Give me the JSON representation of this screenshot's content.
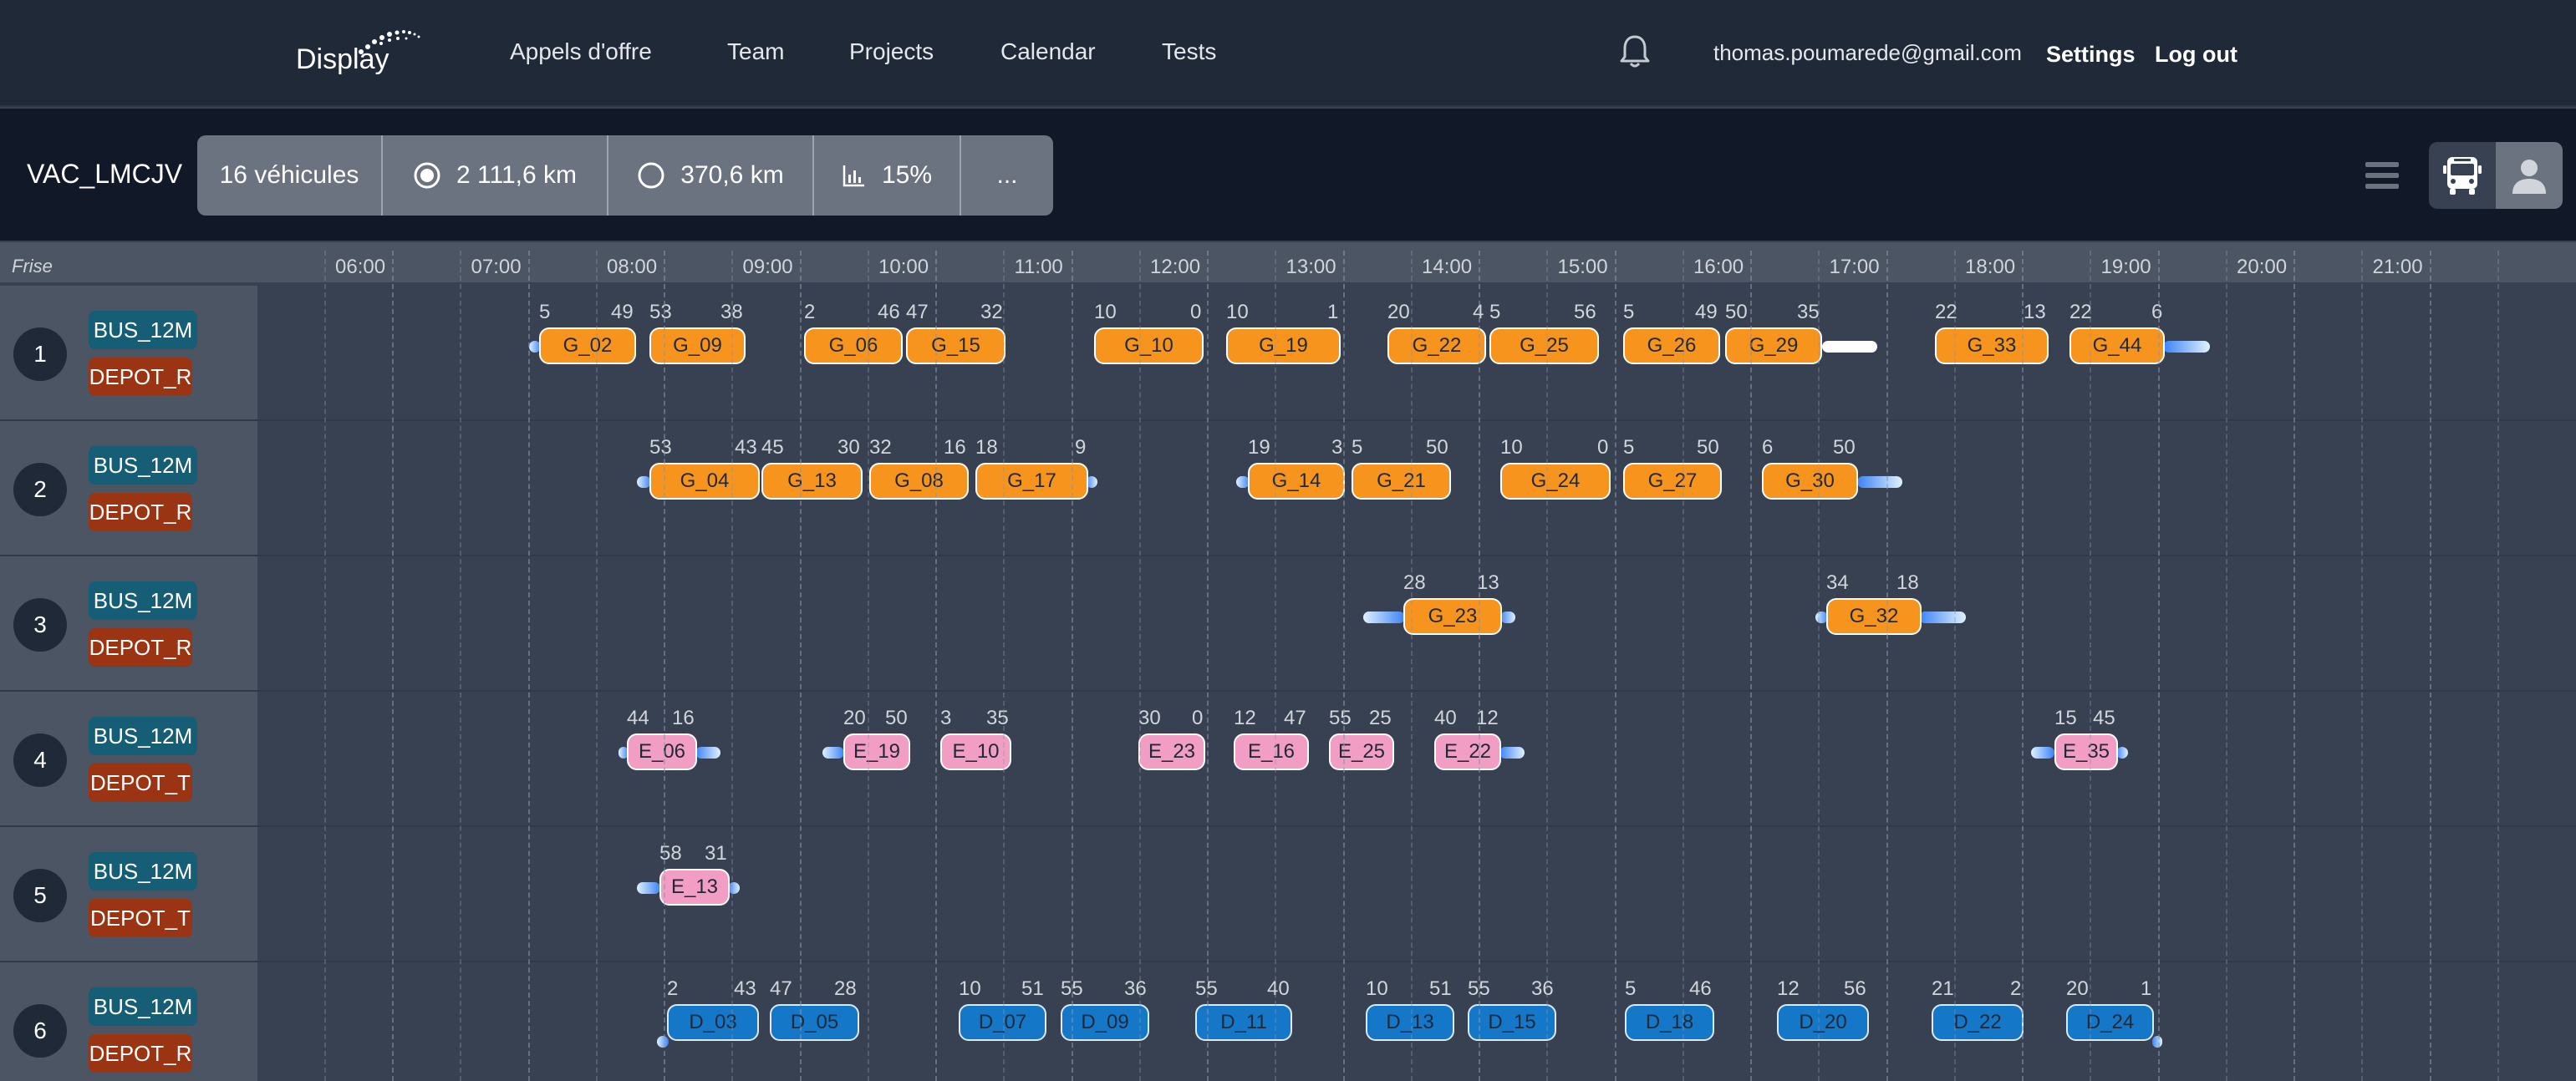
{
  "nav": {
    "logo_text": "Display",
    "links": [
      "Appels d'offre",
      "Team",
      "Projects",
      "Calendar",
      "Tests"
    ],
    "user_email": "thomas.poumarede@gmail.com",
    "settings": "Settings",
    "logout": "Log out"
  },
  "toolbar": {
    "scenario": "VAC_LMCJV",
    "stats": {
      "vehicles": "16 véhicules",
      "commercial_km": "2 111,6 km",
      "deadhead_km": "370,6 km",
      "ratio": "15%",
      "more": "..."
    }
  },
  "timeline": {
    "frise_label": "Frise",
    "hours": [
      "06:00",
      "07:00",
      "08:00",
      "09:00",
      "10:00",
      "11:00",
      "12:00",
      "13:00",
      "14:00",
      "15:00",
      "16:00",
      "17:00",
      "18:00",
      "19:00",
      "20:00",
      "21:00"
    ]
  },
  "rows": [
    {
      "num": "1",
      "bus": "BUS_12M",
      "depot": "DEPOT_R",
      "trips": [
        {
          "label": "G_02",
          "c": "orange",
          "s": "5",
          "e": "49"
        },
        {
          "label": "G_09",
          "c": "orange",
          "s": "53",
          "e": "38"
        },
        {
          "label": "G_06",
          "c": "orange",
          "s": "2",
          "e": "46"
        },
        {
          "label": "G_15",
          "c": "orange",
          "s": "47",
          "e": "32"
        },
        {
          "label": "G_10",
          "c": "orange",
          "s": "10",
          "e": "0"
        },
        {
          "label": "G_19",
          "c": "orange",
          "s": "10",
          "e": "1"
        },
        {
          "label": "G_22",
          "c": "orange",
          "s": "20",
          "e": "4"
        },
        {
          "label": "G_25",
          "c": "orange",
          "s": "5",
          "e": "56"
        },
        {
          "label": "G_26",
          "c": "orange",
          "s": "5",
          "e": "49"
        },
        {
          "label": "G_29",
          "c": "orange",
          "s": "50",
          "e": "35"
        },
        {
          "label": "G_33",
          "c": "orange",
          "s": "22",
          "e": "13"
        },
        {
          "label": "G_44",
          "c": "orange",
          "s": "22",
          "e": "6"
        }
      ]
    },
    {
      "num": "2",
      "bus": "BUS_12M",
      "depot": "DEPOT_R",
      "trips": [
        {
          "label": "G_04",
          "c": "orange",
          "s": "53",
          "e": "43"
        },
        {
          "label": "G_13",
          "c": "orange",
          "s": "45",
          "e": "30"
        },
        {
          "label": "G_08",
          "c": "orange",
          "s": "32",
          "e": "16"
        },
        {
          "label": "G_17",
          "c": "orange",
          "s": "18",
          "e": "9"
        },
        {
          "label": "G_14",
          "c": "orange",
          "s": "19",
          "e": "3"
        },
        {
          "label": "G_21",
          "c": "orange",
          "s": "5",
          "e": "50"
        },
        {
          "label": "G_24",
          "c": "orange",
          "s": "10",
          "e": "0"
        },
        {
          "label": "G_27",
          "c": "orange",
          "s": "5",
          "e": "50"
        },
        {
          "label": "G_30",
          "c": "orange",
          "s": "6",
          "e": "50"
        }
      ]
    },
    {
      "num": "3",
      "bus": "BUS_12M",
      "depot": "DEPOT_R",
      "trips": [
        {
          "label": "G_23",
          "c": "orange",
          "s": "28",
          "e": "13"
        },
        {
          "label": "G_32",
          "c": "orange",
          "s": "34",
          "e": "18"
        }
      ]
    },
    {
      "num": "4",
      "bus": "BUS_12M",
      "depot": "DEPOT_T",
      "trips": [
        {
          "label": "E_06",
          "c": "pink",
          "s": "44",
          "e": "16"
        },
        {
          "label": "E_19",
          "c": "pink",
          "s": "20",
          "e": "50"
        },
        {
          "label": "E_10",
          "c": "pink",
          "s": "3",
          "e": "35"
        },
        {
          "label": "E_23",
          "c": "pink",
          "s": "30",
          "e": "0"
        },
        {
          "label": "E_16",
          "c": "pink",
          "s": "12",
          "e": "47"
        },
        {
          "label": "E_25",
          "c": "pink",
          "s": "55",
          "e": "25"
        },
        {
          "label": "E_22",
          "c": "pink",
          "s": "40",
          "e": "12"
        },
        {
          "label": "E_35",
          "c": "pink",
          "s": "15",
          "e": "45"
        }
      ]
    },
    {
      "num": "5",
      "bus": "BUS_12M",
      "depot": "DEPOT_T",
      "trips": [
        {
          "label": "E_13",
          "c": "pink",
          "s": "58",
          "e": "31"
        }
      ]
    },
    {
      "num": "6",
      "bus": "BUS_12M",
      "depot": "DEPOT_R",
      "trips": [
        {
          "label": "D_03",
          "c": "blue",
          "s": "2",
          "e": "43"
        },
        {
          "label": "D_05",
          "c": "blue",
          "s": "47",
          "e": "28"
        },
        {
          "label": "D_07",
          "c": "blue",
          "s": "10",
          "e": "51"
        },
        {
          "label": "D_09",
          "c": "blue",
          "s": "55",
          "e": "36"
        },
        {
          "label": "D_11",
          "c": "blue",
          "s": "55",
          "e": "40"
        },
        {
          "label": "D_13",
          "c": "blue",
          "s": "10",
          "e": "51"
        },
        {
          "label": "D_15",
          "c": "blue",
          "s": "55",
          "e": "36"
        },
        {
          "label": "D_18",
          "c": "blue",
          "s": "5",
          "e": "46"
        },
        {
          "label": "D_20",
          "c": "blue",
          "s": "12",
          "e": "56"
        },
        {
          "label": "D_22",
          "c": "blue",
          "s": "21",
          "e": "2"
        },
        {
          "label": "D_24",
          "c": "blue",
          "s": "20",
          "e": "1"
        }
      ]
    }
  ]
}
